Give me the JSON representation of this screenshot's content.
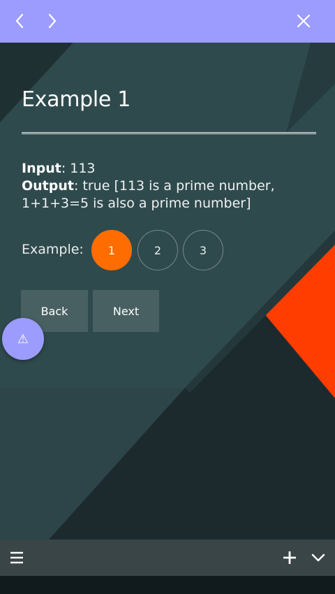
{
  "header": {
    "back_icon": "chevron-left-icon",
    "forward_icon": "chevron-right-icon",
    "close_icon": "close-icon",
    "background_color": "#9c9cff"
  },
  "main": {
    "title": "Example 1",
    "input_label": "Input",
    "input_value": ": 113",
    "output_label": "Output",
    "output_value": ": true [113 is a prime number, 1+1+3=5 is also a prime number]",
    "example_label": "Example:",
    "examples": [
      "1",
      "2",
      "3"
    ],
    "selected_example": "1",
    "back_label": "Back",
    "next_label": "Next"
  },
  "fab": {
    "icon": "warning-icon",
    "glyph": "⚠"
  },
  "footer": {
    "menu_icon": "menu-icon",
    "add_icon": "plus-icon",
    "expand_icon": "chevron-down-icon"
  },
  "colors": {
    "accent": "#ff6d00",
    "bar": "#9c9cff",
    "background": "#2f4a4d",
    "orange_shape": "#ff3d00"
  }
}
